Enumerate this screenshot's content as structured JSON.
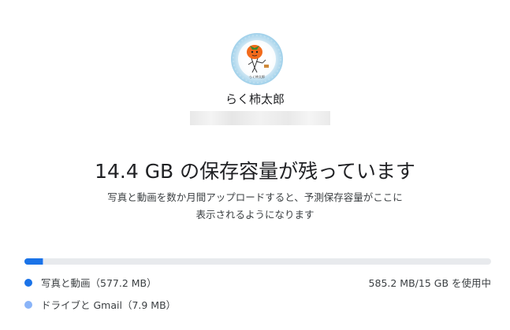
{
  "account": {
    "avatar_icon": "persimmon-character-avatar-icon",
    "avatar_caption": "らく柿太郎",
    "name": "らく柿太郎"
  },
  "storage": {
    "headline": "14.4 GB の保存容量が残っています",
    "description_line1": "写真と動画を数か月間アップロードすると、予測保存容量がここに",
    "description_line2": "表示されるようになります",
    "usage_summary": "585.2 MB/15 GB を使用中",
    "used_fraction": 0.039,
    "colors": {
      "photos": "#1a73e8",
      "drive": "#8ab4f8",
      "track": "#e8eaed"
    },
    "breakdown": [
      {
        "label": "写真と動画（577.2 MB）",
        "fraction_of_total": 0.0385,
        "color": "#1a73e8"
      },
      {
        "label": "ドライブと Gmail（7.9 MB）",
        "fraction_of_total": 0.0005,
        "color": "#8ab4f8"
      }
    ]
  }
}
